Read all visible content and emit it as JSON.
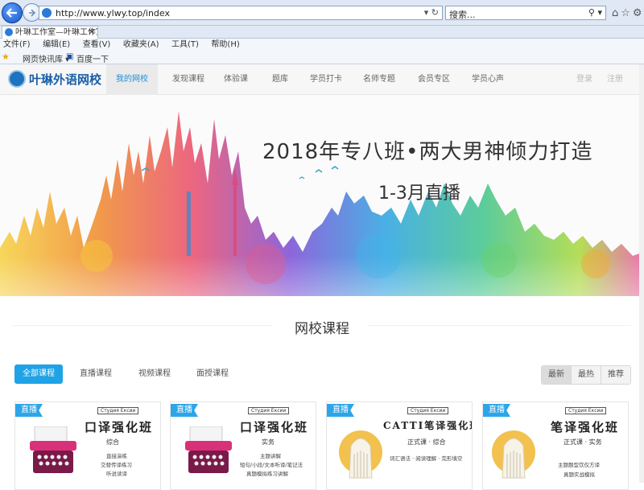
{
  "browser": {
    "url": "http://www.ylwy.top/index",
    "search_placeholder": "搜索...",
    "tab_title": "叶琳工作室—叶琳工作室,叶...",
    "menu": [
      "文件(F)",
      "编辑(E)",
      "查看(V)",
      "收藏夹(A)",
      "工具(T)",
      "帮助(H)"
    ],
    "favorites": [
      "网页快讯库 ▾",
      "百度一下"
    ]
  },
  "site": {
    "logo_text": "叶琳外语网校",
    "nav": [
      "我的网校",
      "发现课程",
      "体验课",
      "题库",
      "学员打卡",
      "名师专题",
      "会员专区",
      "学员心声"
    ],
    "login": "登录",
    "register": "注册"
  },
  "banner": {
    "title": "2018年专八班•两大男神倾力打造",
    "subtitle": "1-3月直播"
  },
  "section": {
    "title": "网校课程"
  },
  "filters": [
    "全部课程",
    "直播课程",
    "视频课程",
    "面授课程"
  ],
  "sort": [
    "最新",
    "最热",
    "推荐"
  ],
  "cards": [
    {
      "badge": "直播",
      "tag": "Студия Ексии",
      "title": "口译强化班",
      "sub": "综合",
      "details": [
        "直接演练",
        "交替传译练习",
        "听说读译"
      ],
      "accent": "#d8317a"
    },
    {
      "badge": "直播",
      "tag": "Студия Ексии",
      "title": "口译强化班",
      "sub": "实务",
      "details": [
        "主题讲解",
        "短句/小段/文本听译/笔记法",
        "真题模拟练习讲解"
      ],
      "accent": "#d8317a"
    },
    {
      "badge": "直播",
      "tag": "Студия Ексии",
      "title": "CATTI笔译强化班",
      "sub": "正式课 · 综合",
      "details": [
        "词汇语法 · 阅读理解 · 完形填空"
      ],
      "accent": "#f2c14e"
    },
    {
      "badge": "直播",
      "tag": "Студия Ексии",
      "title": "笔译强化班",
      "sub": "正式课 · 实务",
      "details": [
        "主题题型饮仅方译",
        "真题实战模拟"
      ],
      "accent": "#f2c14e"
    }
  ],
  "colors": {
    "primary": "#1fa2e6",
    "brand": "#1a5fa8",
    "badge": "#2ca6e8"
  }
}
